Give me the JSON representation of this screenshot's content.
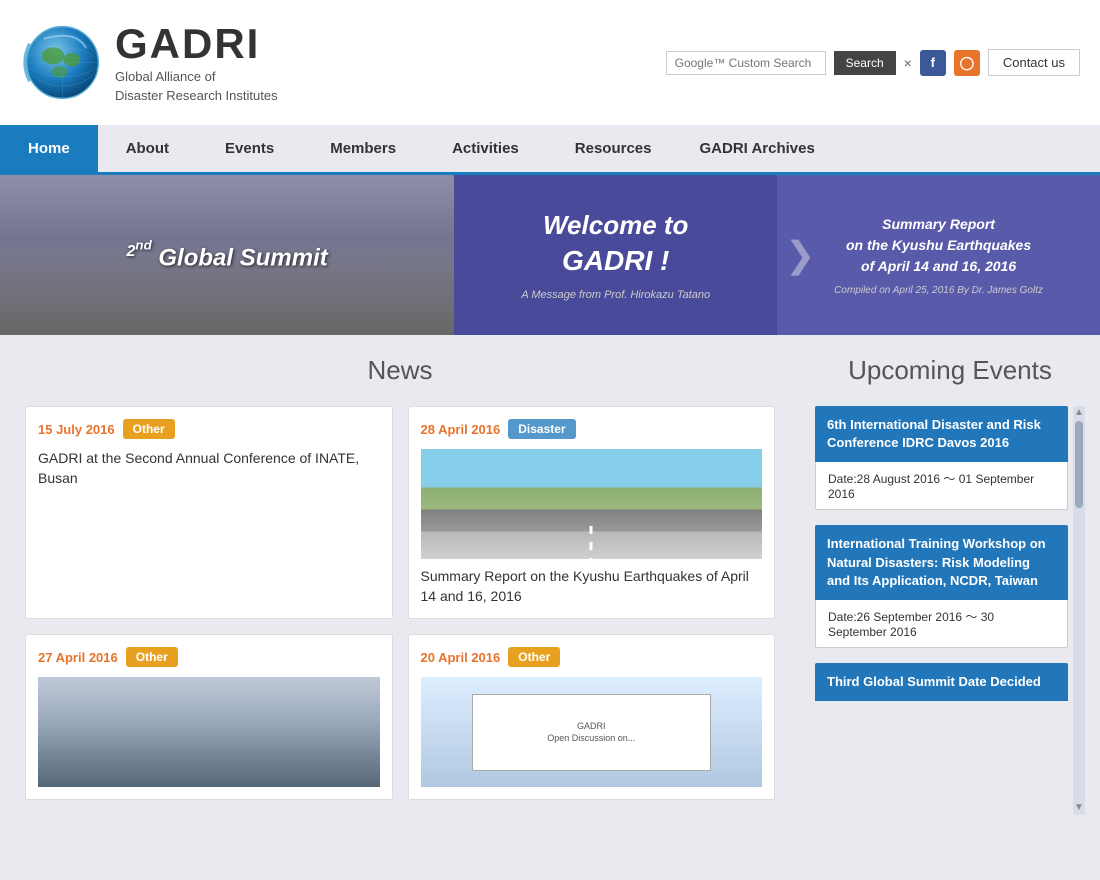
{
  "header": {
    "logo_title": "GADRI",
    "logo_line1": "Global Alliance of",
    "logo_line2": "Disaster Research Institutes",
    "search_placeholder": "Google™ Custom Search",
    "search_label": "Search",
    "search_clear": "×",
    "contact_label": "Contact us"
  },
  "nav": {
    "items": [
      {
        "label": "Home",
        "active": true
      },
      {
        "label": "About",
        "active": false
      },
      {
        "label": "Events",
        "active": false
      },
      {
        "label": "Members",
        "active": false
      },
      {
        "label": "Activities",
        "active": false
      },
      {
        "label": "Resources",
        "active": false
      },
      {
        "label": "GADRI Archives",
        "active": false
      }
    ]
  },
  "banner": {
    "slide1_heading_pre": "2",
    "slide1_heading_sup": "nd",
    "slide1_heading_post": " Global Summit",
    "slide2_line1": "Welcome  to",
    "slide2_line2": "GADRI !",
    "slide2_sub": "A Message from Prof. Hirokazu Tatano",
    "slide3_line1": "Summary Report",
    "slide3_line2": "on the Kyushu Earthquakes",
    "slide3_line3": "of April 14 and 16, 2016",
    "slide3_compiled": "Compiled on April 25, 2016 By Dr. James Goltz"
  },
  "news": {
    "section_title": "News",
    "cards": [
      {
        "date": "15 July 2016",
        "tag": "Other",
        "tag_type": "other",
        "title": "GADRI at the Second Annual Conference of INATE, Busan",
        "has_image": false
      },
      {
        "date": "28 April 2016",
        "tag": "Disaster",
        "tag_type": "disaster",
        "title": "Summary Report on the Kyushu Earthquakes of April 14 and 16, 2016",
        "has_image": true,
        "image_type": "road"
      },
      {
        "date": "27 April 2016",
        "tag": "Other",
        "tag_type": "other",
        "title": "",
        "has_image": true,
        "image_type": "crowd"
      },
      {
        "date": "20 April 2016",
        "tag": "Other",
        "tag_type": "other",
        "title": "",
        "has_image": true,
        "image_type": "doc"
      }
    ]
  },
  "events": {
    "section_title": "Upcoming Events",
    "cards": [
      {
        "title": "6th International Disaster and Risk Conference IDRC Davos 2016",
        "date": "Date:28 August 2016 ～ 01 September 2016"
      },
      {
        "title": "International Training Workshop on Natural Disasters: Risk Modeling and Its Application, NCDR, Taiwan",
        "date": "Date:26 September 2016 ～ 30 September 2016"
      },
      {
        "title": "Third Global Summit Date Decided",
        "date": ""
      }
    ]
  }
}
